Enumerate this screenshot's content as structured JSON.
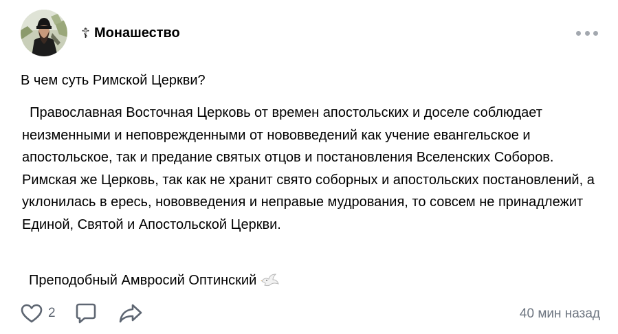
{
  "community": {
    "icon": "orthodox-cross-icon",
    "icon_glyph": "☦",
    "name": "Монашество"
  },
  "menu": {
    "icon": "more-horizontal-icon"
  },
  "post": {
    "title": "В чем суть Римской Церкви?",
    "body": "  Православная Восточная Церковь от времен апостольских и доселе соблюдает неизменными и неповрежденными от нововведений как учение евангельское и апостольское, так и предание святых отцов и постановления Вселенских Соборов. Римская же Церковь, так как не хранит свято соборных и апостольских постановлений, а уклонилась в ересь, нововведения и неправые мудрования, то совсем не принадлежит Единой, Святой и Апостольской Церкви.",
    "signature": "Преподобный Амвросий Оптинский",
    "signature_emoji": "dove-icon"
  },
  "actions": {
    "like_icon": "heart-icon",
    "like_count": "2",
    "comment_icon": "comment-icon",
    "share_icon": "share-icon"
  },
  "timestamp": "40 мин назад",
  "colors": {
    "icon_gray": "#5e6672",
    "dots_gray": "#a3a8af",
    "time_gray": "#6d7580"
  }
}
